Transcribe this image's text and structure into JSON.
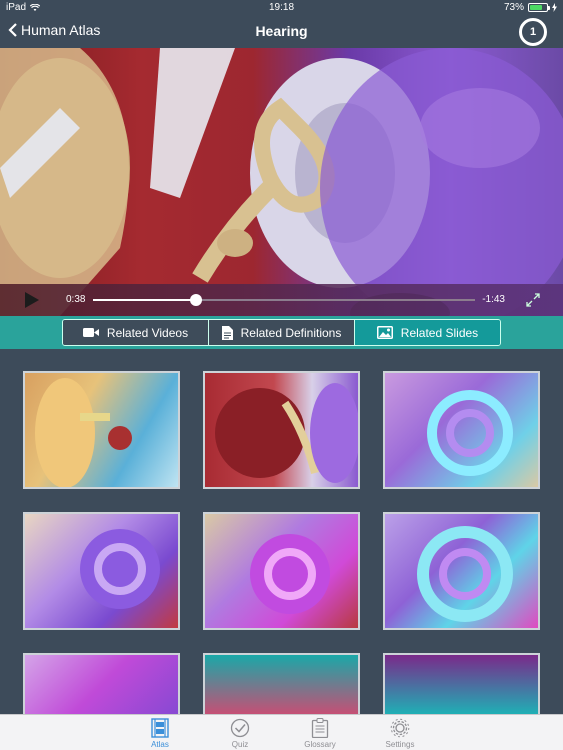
{
  "status_bar": {
    "carrier": "iPad",
    "time": "19:18",
    "battery": "73%",
    "battery_level": 0.73
  },
  "nav": {
    "back_label": "Human Atlas",
    "title": "Hearing",
    "badge": "1"
  },
  "video": {
    "elapsed": "0:38",
    "remaining": "-1:43",
    "progress": 0.27
  },
  "segments": [
    {
      "label": "Related Videos",
      "icon": "video-camera-icon"
    },
    {
      "label": "Related Definitions",
      "icon": "document-icon"
    },
    {
      "label": "Related Slides",
      "icon": "image-icon",
      "active": true
    }
  ],
  "slides_count_visible": 9,
  "tabs": [
    {
      "label": "Atlas",
      "icon": "film-icon",
      "active": true
    },
    {
      "label": "Quiz",
      "icon": "checkmark-circle-icon"
    },
    {
      "label": "Glossary",
      "icon": "clipboard-icon"
    },
    {
      "label": "Settings",
      "icon": "gear-icon"
    }
  ],
  "colors": {
    "accent": "#2aa39b",
    "segment_active": "#149a9a",
    "background": "#3d4b5a",
    "tab_active": "#3b8fd9"
  }
}
